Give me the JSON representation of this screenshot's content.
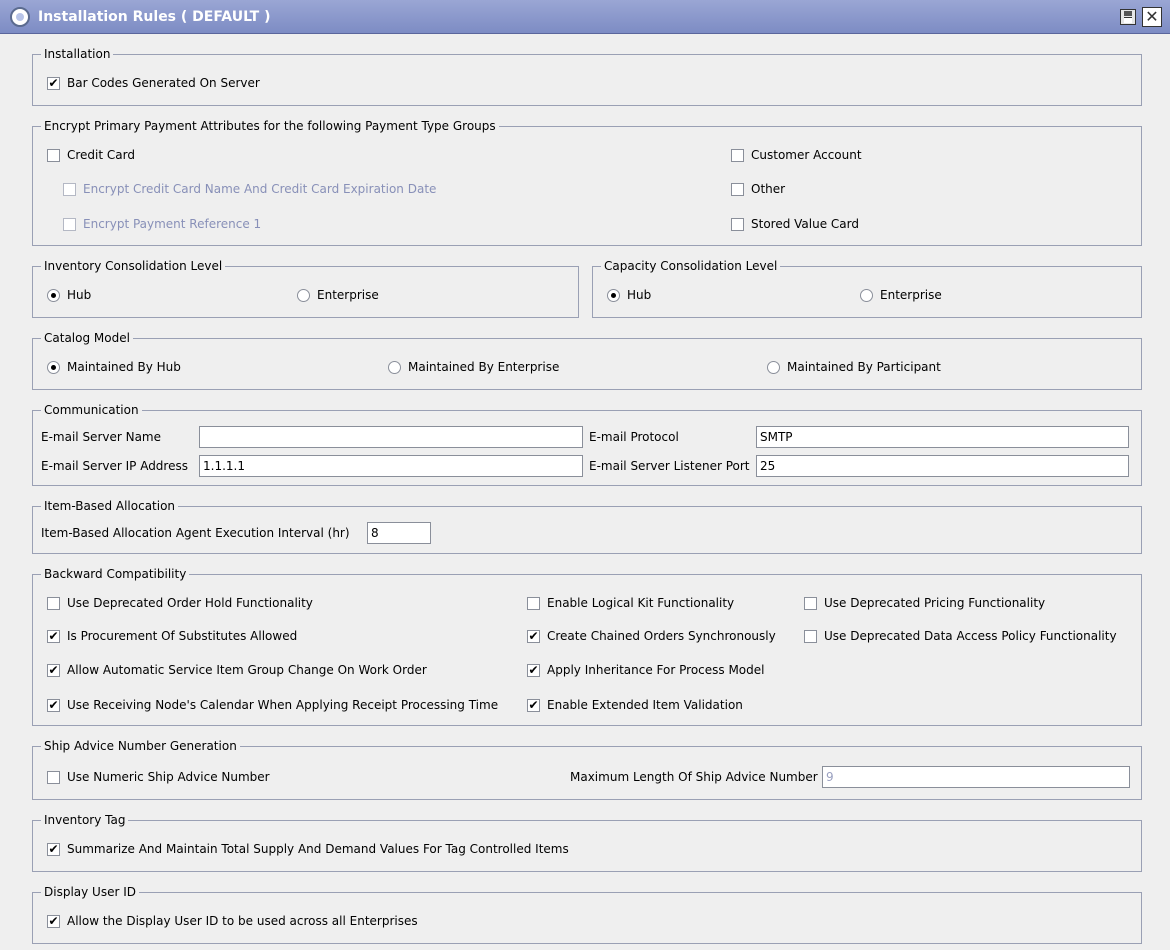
{
  "window": {
    "title": "Installation Rules ( DEFAULT )"
  },
  "installation": {
    "legend": "Installation",
    "barcodes": {
      "label": "Bar Codes Generated On Server",
      "checked": true
    }
  },
  "encrypt": {
    "legend": "Encrypt Primary Payment Attributes for the following Payment Type Groups",
    "credit_card": {
      "label": "Credit Card",
      "checked": false
    },
    "encrypt_cc_name": {
      "label": "Encrypt Credit Card Name And Credit Card Expiration Date",
      "checked": false
    },
    "encrypt_payment_ref": {
      "label": "Encrypt Payment Reference 1",
      "checked": false
    },
    "customer_account": {
      "label": "Customer Account",
      "checked": false
    },
    "other": {
      "label": "Other",
      "checked": false
    },
    "stored_value_card": {
      "label": "Stored Value Card",
      "checked": false
    }
  },
  "inventory_consolidation": {
    "legend": "Inventory Consolidation Level",
    "hub": "Hub",
    "enterprise": "Enterprise",
    "selected": "Hub"
  },
  "capacity_consolidation": {
    "legend": "Capacity Consolidation Level",
    "hub": "Hub",
    "enterprise": "Enterprise",
    "selected": "Hub"
  },
  "catalog_model": {
    "legend": "Catalog Model",
    "by_hub": "Maintained By Hub",
    "by_enterprise": "Maintained By Enterprise",
    "by_participant": "Maintained By Participant",
    "selected": "Maintained By Hub"
  },
  "communication": {
    "legend": "Communication",
    "server_name_label": "E-mail Server Name",
    "server_name_value": "",
    "ip_label": "E-mail Server IP Address",
    "ip_value": "1.1.1.1",
    "protocol_label": "E-mail Protocol",
    "protocol_value": "SMTP",
    "port_label": "E-mail Server Listener Port",
    "port_value": "25"
  },
  "item_allocation": {
    "legend": "Item-Based Allocation",
    "interval_label": "Item-Based Allocation Agent Execution Interval (hr)",
    "interval_value": "8"
  },
  "backward": {
    "legend": "Backward Compatibility",
    "items": [
      {
        "label": "Use Deprecated Order Hold Functionality",
        "checked": false
      },
      {
        "label": "Is Procurement Of Substitutes Allowed",
        "checked": true
      },
      {
        "label": "Allow Automatic Service Item Group Change On Work Order",
        "checked": true
      },
      {
        "label": "Use Receiving Node's Calendar When Applying Receipt Processing Time",
        "checked": true
      },
      {
        "label": "Enable Logical Kit Functionality",
        "checked": false
      },
      {
        "label": "Create Chained Orders Synchronously",
        "checked": true
      },
      {
        "label": "Apply Inheritance For Process Model",
        "checked": true
      },
      {
        "label": "Enable Extended Item Validation",
        "checked": true
      },
      {
        "label": "Use Deprecated Pricing Functionality",
        "checked": false
      },
      {
        "label": "Use Deprecated Data Access Policy Functionality",
        "checked": false
      }
    ]
  },
  "ship_advice": {
    "legend": "Ship Advice Number Generation",
    "numeric_label": "Use Numeric Ship Advice Number",
    "numeric_checked": false,
    "maxlen_label": "Maximum Length Of Ship Advice Number",
    "maxlen_value": "9"
  },
  "inventory_tag": {
    "legend": "Inventory Tag",
    "summarize_label": "Summarize And Maintain Total Supply And Demand Values For Tag Controlled Items",
    "summarize_checked": true
  },
  "display_user": {
    "legend": "Display User ID",
    "allow_label": "Allow the Display User ID to be used across all Enterprises",
    "allow_checked": true
  }
}
